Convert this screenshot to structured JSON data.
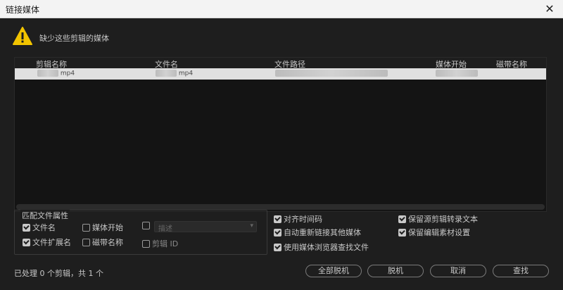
{
  "window": {
    "title": "链接媒体",
    "close_label": "✕"
  },
  "warning": {
    "icon": "warning-icon",
    "message": "缺少这些剪辑的媒体"
  },
  "table": {
    "columns": [
      "剪辑名称",
      "文件名",
      "文件路径",
      "媒体开始",
      "磁带名称"
    ],
    "rows": [
      {
        "clip_name": "mp4",
        "file_name": "mp4"
      }
    ]
  },
  "match_properties": {
    "title": "匹配文件属性",
    "file_name": {
      "label": "文件名",
      "checked": true
    },
    "media_start": {
      "label": "媒体开始",
      "checked": false
    },
    "description": {
      "label": "",
      "checked": false,
      "placeholder": "描述"
    },
    "file_extension": {
      "label": "文件扩展名",
      "checked": true
    },
    "tape_name": {
      "label": "磁带名称",
      "checked": false
    },
    "clip_id": {
      "label": "剪辑 ID",
      "checked": false
    }
  },
  "options": {
    "align_timecode": {
      "label": "对齐时间码",
      "checked": true
    },
    "relink_others": {
      "label": "自动重新链接其他媒体",
      "checked": true
    },
    "use_media_browser": {
      "label": "使用媒体浏览器查找文件",
      "checked": true
    },
    "preserve_source_clip": {
      "label": "保留源剪辑转录文本",
      "checked": true
    },
    "preserve_edited_material": {
      "label": "保留编辑素材设置",
      "checked": true
    }
  },
  "status": "已处理 0 个剪辑，共 1 个",
  "buttons": {
    "offline_all": "全部脱机",
    "offline": "脱机",
    "cancel": "取消",
    "find": "查找"
  },
  "colors": {
    "background": "#1e1e1e",
    "selected_row": "#e0e0e0",
    "warning": "#f2c400"
  }
}
